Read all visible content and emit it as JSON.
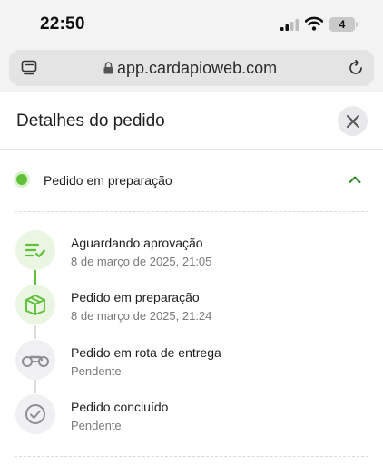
{
  "status_bar": {
    "time": "22:50",
    "battery_level": "4",
    "signal_icon": "cellular-signal-icon",
    "wifi_icon": "wifi-icon"
  },
  "browser": {
    "url": "app.cardapioweb.com",
    "tabs_icon": "tabs-icon",
    "lock_icon": "lock-icon",
    "reload_icon": "reload-icon"
  },
  "modal": {
    "title": "Detalhes do pedido",
    "close_icon": "close-icon"
  },
  "current_status": {
    "label": "Pedido em preparação",
    "color": "#5fc03a",
    "toggle_icon": "chevron-up-icon"
  },
  "timeline": {
    "done_color": "#5fc03a",
    "pending_color": "#8e8e93",
    "steps": [
      {
        "title": "Aguardando aprovação",
        "subtitle": "8 de março de 2025, 21:05",
        "state": "done",
        "icon": "list-check-icon"
      },
      {
        "title": "Pedido em preparação",
        "subtitle": "8 de março de 2025, 21:24",
        "state": "done",
        "icon": "package-box-icon"
      },
      {
        "title": "Pedido em rota de entrega",
        "subtitle": "Pendente",
        "state": "pending",
        "icon": "motorcycle-icon"
      },
      {
        "title": "Pedido concluído",
        "subtitle": "Pendente",
        "state": "pending",
        "icon": "check-circle-icon"
      }
    ]
  }
}
